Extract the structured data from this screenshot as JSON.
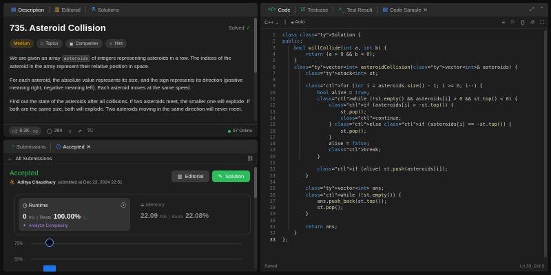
{
  "left_tabs": {
    "description": "Description",
    "editorial": "Editorial",
    "solutions": "Solutions"
  },
  "problem": {
    "title": "735. Asteroid Collision",
    "status": "Solved",
    "chips": {
      "difficulty": "Medium",
      "topics": "Topics",
      "companies": "Companies",
      "hint": "Hint"
    },
    "p1_before": "We are given an array ",
    "p1_code": "asteroids",
    "p1_after": " of integers representing asteroids in a row. The indices of the asteroid in the array represent their relative position in space.",
    "p2": "For each asteroid, the absolute value represents its size, and the sign represents its direction (positive meaning right, negative meaning left). Each asteroid moves at the same speed.",
    "p3": "Find out the state of the asteroids after all collisions. If two asteroids meet, the smaller one will explode. If both are the same size, both will explode. Two asteroids moving in the same direction will never meet."
  },
  "desc_footer": {
    "likes": "8.3K",
    "comments": "264",
    "online": "97 Online"
  },
  "sub_tabs": {
    "submissions": "Submissions",
    "accepted": "Accepted"
  },
  "submission": {
    "back": "All Submissions",
    "status": "Accepted",
    "author": "Aditya Chaudhary",
    "submitted": "submitted at Dec 22, 2024 22:51",
    "editorial_btn": "Editorial",
    "solution_btn": "Solution",
    "runtime_label": "Runtime",
    "runtime_value": "0",
    "runtime_unit": "ms",
    "beats_label": "Beats",
    "runtime_beats": "100.00%",
    "analyze": "Analyze Complexity",
    "memory_label": "Memory",
    "memory_value": "22.09",
    "memory_unit": "MB",
    "memory_beats": "22.08%"
  },
  "chart_data": {
    "type": "bar",
    "ytick_labels": [
      "75%",
      "50%"
    ],
    "yticks": [
      75,
      50
    ],
    "ylim": [
      30,
      85
    ],
    "values": [
      40
    ],
    "highlight_color": "#1a73e8"
  },
  "code_tabs": {
    "code": "Code",
    "testcase": "Testcase",
    "result": "Test Result",
    "sample": "Code Sample"
  },
  "editor": {
    "language": "C++",
    "mode": "Auto",
    "saved": "Saved",
    "cursor": "Ln 33, Col 3",
    "lines": [
      "class Solution {",
      "public:",
      "    bool willCollide(int a, int b) {",
      "        return (a > 0 && b < 0);",
      "    }",
      "    vector<int> asteroidCollision(vector<int>& asteroids) {",
      "        stack<int> st;",
      "",
      "        for (int i = asteroids.size() - 1; i >= 0; i--) {",
      "            bool alive = true;",
      "            while (!st.empty() && asteroids[i] > 0 && st.top() < 0) {",
      "                if (asteroids[i] > -st.top()) {",
      "                    st.pop();",
      "                    continue;",
      "                } else if (asteroids[i] == -st.top()) {",
      "                    st.pop();",
      "                }",
      "                alive = false;",
      "                break;",
      "            }",
      "",
      "            if (alive) st.push(asteroids[i]);",
      "        }",
      "",
      "        vector<int> ans;",
      "        while (!st.empty()) {",
      "            ans.push_back(st.top());",
      "            st.pop();",
      "        }",
      "",
      "        return ans;",
      "    }",
      "};"
    ]
  },
  "colors": {
    "accent_green": "#2cbb5d",
    "accent_blue": "#4b8df8",
    "medium": "#ffb700",
    "bg": "#1e1e1e"
  }
}
